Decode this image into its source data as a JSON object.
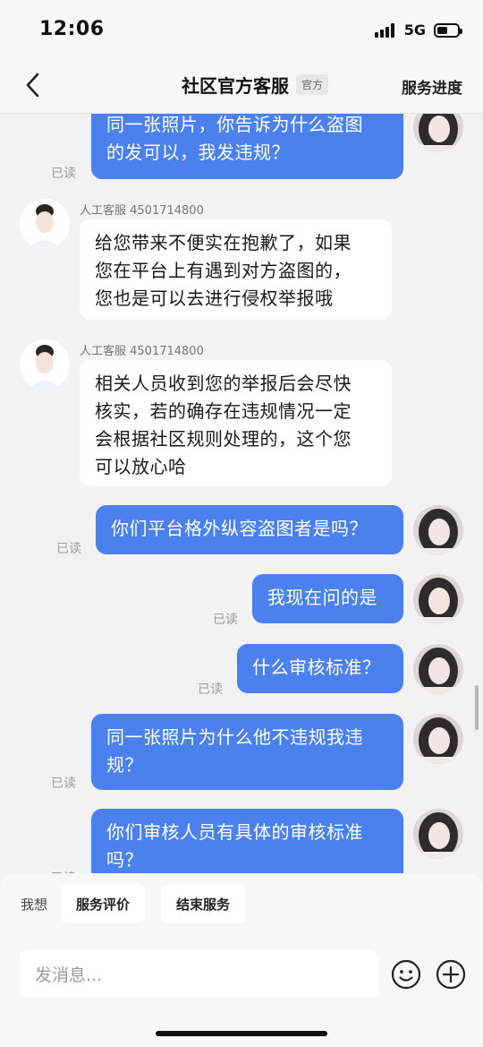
{
  "status_bar": {
    "time": "12:06",
    "network": "5G",
    "battery_level": 0.5
  },
  "nav": {
    "title": "社区官方客服",
    "badge": "官方",
    "right_action": "服务进度"
  },
  "colors": {
    "user_bubble": "#4b81ee",
    "agent_bubble": "#ffffff",
    "background": "#f2f2f2"
  },
  "messages": [
    {
      "sender": "user",
      "lines": [
        "同一张照片，你告诉为什么盗图",
        "的发可以，我发违规？"
      ],
      "status": "已读"
    },
    {
      "sender": "agent",
      "agent_name": "人工客服 4501714800",
      "lines": [
        "给您带来不便实在抱歉了，如果",
        "您在平台上有遇到对方盗图的，",
        "您也是可以去进行侵权举报哦"
      ]
    },
    {
      "sender": "agent",
      "agent_name": "人工客服 4501714800",
      "lines": [
        "相关人员收到您的举报后会尽快",
        "核实，若的确存在违规情况一定",
        "会根据社区规则处理的，这个您",
        "可以放心哈"
      ]
    },
    {
      "sender": "user",
      "lines": [
        "你们平台格外纵容盗图者是吗？"
      ],
      "status": "已读"
    },
    {
      "sender": "user",
      "lines": [
        "我现在问的是"
      ],
      "status": "已读"
    },
    {
      "sender": "user",
      "lines": [
        "什么审核标准？"
      ],
      "status": "已读"
    },
    {
      "sender": "user",
      "lines": [
        "同一张照片为什么他不违规我违",
        "规？"
      ],
      "status": "已读"
    },
    {
      "sender": "user",
      "lines": [
        "你们审核人员有具体的审核标准",
        "吗？"
      ],
      "status": "已读"
    }
  ],
  "quick_replies": {
    "label": "我想",
    "options": [
      "服务评价",
      "结束服务"
    ]
  },
  "input": {
    "placeholder": "发消息..."
  },
  "icons": {
    "back": "chevron-left-icon",
    "emoji": "emoji-icon",
    "add": "plus-circle-icon"
  }
}
